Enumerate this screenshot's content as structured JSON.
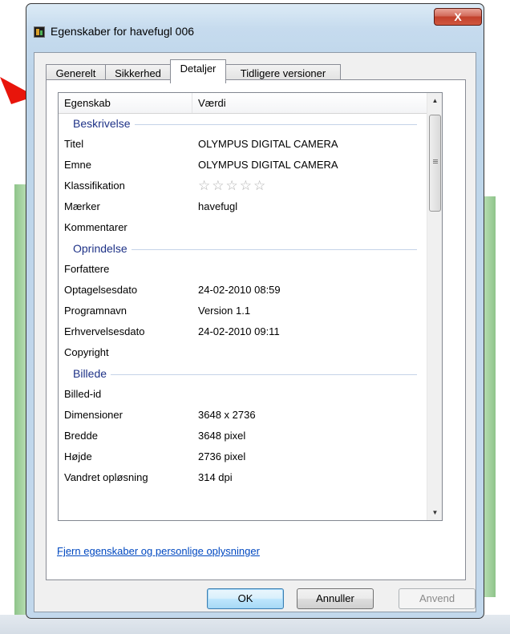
{
  "window": {
    "title": "Egenskaber for havefugl 006",
    "close_label": "X"
  },
  "tabs": [
    {
      "label": "Generelt"
    },
    {
      "label": "Sikkerhed"
    },
    {
      "label": "Detaljer"
    },
    {
      "label": "Tidligere versioner"
    }
  ],
  "active_tab": "Detaljer",
  "listview": {
    "col_property": "Egenskab",
    "col_value": "Værdi",
    "groups": [
      {
        "label": "Beskrivelse",
        "rows": [
          {
            "key": "Titel",
            "value": "OLYMPUS DIGITAL CAMERA"
          },
          {
            "key": "Emne",
            "value": "OLYMPUS DIGITAL CAMERA"
          },
          {
            "key": "Klassifikation",
            "value": "☆☆☆☆☆"
          },
          {
            "key": "Mærker",
            "value": "havefugl"
          },
          {
            "key": "Kommentarer",
            "value": ""
          }
        ]
      },
      {
        "label": "Oprindelse",
        "rows": [
          {
            "key": "Forfattere",
            "value": ""
          },
          {
            "key": "Optagelsesdato",
            "value": "24-02-2010 08:59"
          },
          {
            "key": "Programnavn",
            "value": "Version 1.1"
          },
          {
            "key": "Erhvervelsesdato",
            "value": "24-02-2010 09:11"
          },
          {
            "key": "Copyright",
            "value": ""
          }
        ]
      },
      {
        "label": "Billede",
        "rows": [
          {
            "key": "Billed-id",
            "value": ""
          },
          {
            "key": "Dimensioner",
            "value": "3648 x 2736"
          },
          {
            "key": "Bredde",
            "value": "3648 pixel"
          },
          {
            "key": "Højde",
            "value": "2736 pixel"
          },
          {
            "key": "Vandret opløsning",
            "value": "314 dpi"
          }
        ]
      }
    ],
    "rating_stars": 0
  },
  "remove_link": "Fjern egenskaber og personlige oplysninger",
  "buttons": {
    "ok": "OK",
    "cancel": "Annuller",
    "apply": "Anvend"
  },
  "colors": {
    "group_header": "#1e3287",
    "link": "#0048c0",
    "arrow": "#e8150b"
  }
}
